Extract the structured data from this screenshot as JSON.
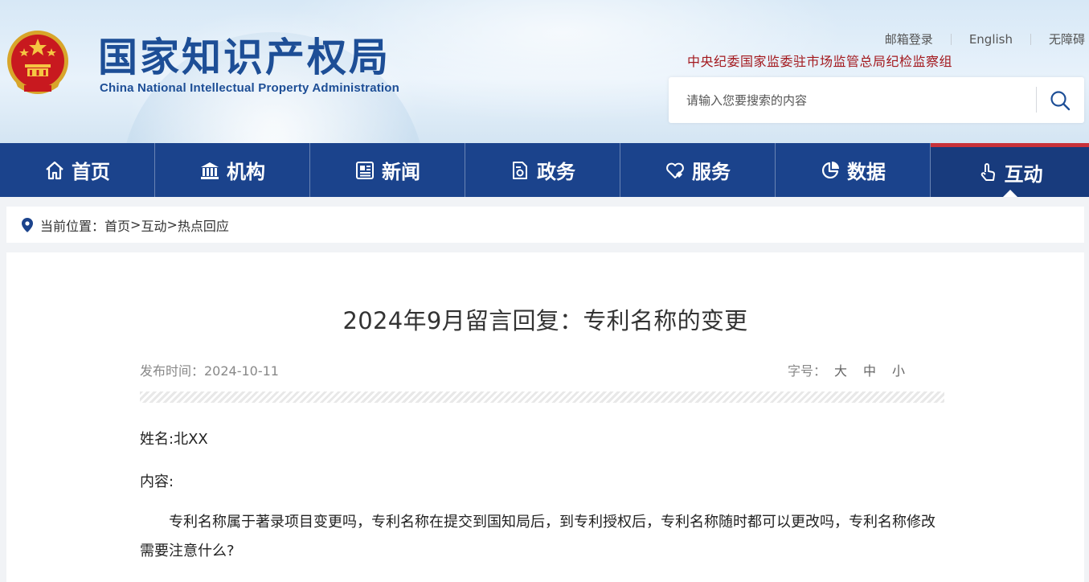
{
  "header": {
    "logo_cn": "国家知识产权局",
    "logo_en": "China National Intellectual Property Administration",
    "top_links": [
      "邮箱登录",
      "English",
      "无障碍"
    ],
    "jiwei": "中央纪委国家监委驻市场监管总局纪检监察组",
    "search": {
      "placeholder": "请输入您要搜索的内容",
      "value": ""
    }
  },
  "nav": {
    "items": [
      {
        "label": "首页",
        "icon": "home-icon"
      },
      {
        "label": "机构",
        "icon": "institution-icon"
      },
      {
        "label": "新闻",
        "icon": "news-icon"
      },
      {
        "label": "政务",
        "icon": "document-icon"
      },
      {
        "label": "服务",
        "icon": "heart-hand-icon"
      },
      {
        "label": "数据",
        "icon": "pie-chart-icon"
      },
      {
        "label": "互动",
        "icon": "touch-icon"
      }
    ],
    "active": "互动"
  },
  "breadcrumb": {
    "prefix": "当前位置：",
    "items": [
      "首页",
      "互动",
      "热点回应"
    ],
    "sep": ">"
  },
  "article": {
    "title": "2024年9月留言回复：专利名称的变更",
    "date": "发布时间：2024-10-11",
    "font_label": "字号：",
    "font_sizes": [
      "大",
      "中",
      "小"
    ],
    "name": "姓名:北XX",
    "content_label": "内容:",
    "body": "专利名称属于著录项目变更吗，专利名称在提交到国知局后，到专利授权后，专利名称随时都可以更改吗，专利名称修改需要注意什么?"
  },
  "colors": {
    "nav_bg": "#1b438c",
    "logo": "#1d4e96",
    "jiwei": "#a3191e",
    "active_top": "#c8323a"
  }
}
